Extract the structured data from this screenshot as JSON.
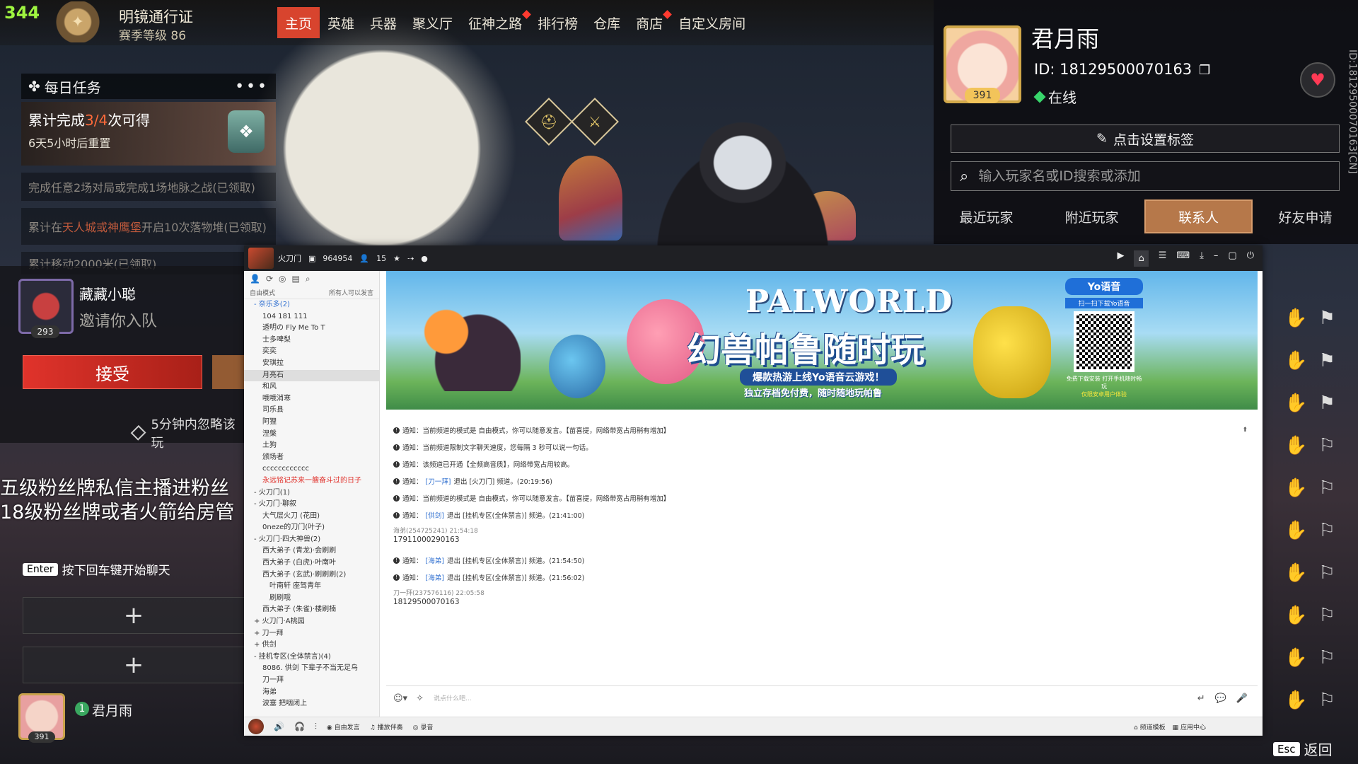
{
  "top": {
    "level": "344",
    "pass_title": "明镜通行证",
    "pass_level": "赛季等级 86",
    "nav": [
      {
        "label": "主页",
        "active": true,
        "badge": false
      },
      {
        "label": "英雄",
        "active": false,
        "badge": false
      },
      {
        "label": "兵器",
        "active": false,
        "badge": false
      },
      {
        "label": "聚义厅",
        "active": false,
        "badge": false
      },
      {
        "label": "征神之路",
        "active": false,
        "badge": true
      },
      {
        "label": "排行榜",
        "active": false,
        "badge": false
      },
      {
        "label": "仓库",
        "active": false,
        "badge": false
      },
      {
        "label": "商店",
        "active": false,
        "badge": true
      },
      {
        "label": "自定义房间",
        "active": false,
        "badge": false
      }
    ]
  },
  "daily": {
    "title": "每日任务",
    "more": "•••",
    "progress_prefix": "累计完成",
    "progress_value": "3/4",
    "progress_suffix": "次可得",
    "reset": "6天5小时后重置",
    "task1": "完成任意2场对局或完成1场地脉之战(已领取)",
    "task2_prefix": "累计在",
    "task2_hl": "天人城或神鹰堡",
    "task2_suffix": "开启10次落物堆(已领取)",
    "task3": "累计移动2000米(已领取)"
  },
  "invite": {
    "name": "藏藏小聪",
    "level": "293",
    "message": "邀请你入队",
    "accept": "接受",
    "ignore": "5分钟内忽略该玩"
  },
  "overlay_chat": {
    "line1": "五级粉丝牌私信主播进粉丝",
    "line2": "18级粉丝牌或者火箭给房管"
  },
  "enter_hint": {
    "key": "Enter",
    "text": "按下回车键开始聊天"
  },
  "self": {
    "name": "君月雨",
    "level": "391",
    "rank": "1"
  },
  "profile": {
    "name": "君月雨",
    "level": "391",
    "id": "ID: 18129500070163",
    "status": "在线",
    "vertical_id": "ID:18129500070163[CN]",
    "set_tag": "点击设置标签",
    "search_placeholder": "输入玩家名或ID搜索或添加",
    "tabs": [
      {
        "label": "最近玩家",
        "active": false
      },
      {
        "label": "附近玩家",
        "active": false
      },
      {
        "label": "联系人",
        "active": true
      },
      {
        "label": "好友申请",
        "active": false
      }
    ]
  },
  "esc_hint": {
    "key": "Esc",
    "text": "返回"
  },
  "yy": {
    "title": "火刀门",
    "channel_id": "964954",
    "online": "15",
    "mode": "自由模式",
    "all_can_speak": "所有人可以发言",
    "tree": [
      {
        "text": "- 奈乐多(2)",
        "cls": "blue"
      },
      {
        "text": "104 181  111",
        "cls": "l1"
      },
      {
        "text": "透明の  Fly Me To T",
        "cls": "l1"
      },
      {
        "text": "士多啤梨",
        "cls": "l1"
      },
      {
        "text": "奕奕",
        "cls": "l1"
      },
      {
        "text": "安琪拉",
        "cls": "l1"
      },
      {
        "text": "月亮石",
        "cls": "l1 sel"
      },
      {
        "text": "和风",
        "cls": "l1"
      },
      {
        "text": "哦哦消寒",
        "cls": "l1"
      },
      {
        "text": "司乐县",
        "cls": "l1"
      },
      {
        "text": "阿狸",
        "cls": "l1"
      },
      {
        "text": "涅槃",
        "cls": "l1"
      },
      {
        "text": "土狗",
        "cls": "l1"
      },
      {
        "text": "颁场者",
        "cls": "l1"
      },
      {
        "text": "cccccccccccc",
        "cls": "l1"
      },
      {
        "text": "永远铭记苏来一艘奋斗过的日子",
        "cls": "l1 red"
      },
      {
        "text": "- 火刀门(1)",
        "cls": ""
      },
      {
        "text": "- 火刀门·聊叙",
        "cls": ""
      },
      {
        "text": "大气层火刀 (花田)",
        "cls": "l1"
      },
      {
        "text": "0neze的刀门(叶子)",
        "cls": "l1"
      },
      {
        "text": "- 火刀门·四大神兽(2)",
        "cls": ""
      },
      {
        "text": "西大弟子 (青龙)·会刷刷",
        "cls": "l1"
      },
      {
        "text": "西大弟子 (白虎)·叶南叶",
        "cls": "l1"
      },
      {
        "text": "西大弟子 (玄武)·刷刷刷(2)",
        "cls": "l1"
      },
      {
        "text": "叶南轩  座驾青年",
        "cls": "l2"
      },
      {
        "text": "刷刷哦",
        "cls": "l2"
      },
      {
        "text": "西大弟子 (朱雀)·楼刷楠",
        "cls": "l1"
      },
      {
        "text": "+ 火刀门·A桃园",
        "cls": ""
      },
      {
        "text": "+ 刀一拜",
        "cls": ""
      },
      {
        "text": "+ 供剑",
        "cls": ""
      },
      {
        "text": "- 挂机专区(全体禁言)(4)",
        "cls": ""
      },
      {
        "text": "8086. 供剑  下辈子不当无足鸟",
        "cls": "l1"
      },
      {
        "text": "刀一拜",
        "cls": "l1"
      },
      {
        "text": "海弟",
        "cls": "l1"
      },
      {
        "text": "波塞  把咽闭上",
        "cls": "l1"
      }
    ],
    "banner": {
      "title": "PALWORLD",
      "slogan": "幻兽帕鲁随时玩",
      "sub1": "爆款热游上线Yo语音云游戏！",
      "sub2": "独立存档免付费，随时随地玩帕鲁",
      "yo_brand": "Yo语音",
      "qr_caption": "扫一扫下载Yo语音",
      "free": "免费下载安装 打开手机随时畅玩",
      "android": "仅限安卓用户体验"
    },
    "messages": [
      {
        "type": "notice",
        "text": "通知：当前频道的模式是 自由模式，你可以随意发言。【苗喜提，网络带宽占用稍有增加】"
      },
      {
        "type": "notice",
        "text": "通知：当前频道限制文字聊天速度，您每隔 3 秒可以说一句话。"
      },
      {
        "type": "notice",
        "text": "通知：该频道已开通【全频高音质】，网络带宽占用较高。"
      },
      {
        "type": "notice",
        "pre": "通知：",
        "who": "[刀一拜]",
        "text": " 退出 [火刀门] 频道。(20:19:56)"
      },
      {
        "type": "notice",
        "text": "通知：当前频道的模式是 自由模式，你可以随意发言。【苗喜提，网络带宽占用稍有增加】"
      },
      {
        "type": "notice",
        "pre": "通知：",
        "who": "[供剑]",
        "text": " 退出 [挂机专区(全体禁言)] 频道。(21:41:00)"
      },
      {
        "type": "user",
        "user": "海弟(254725241)  21:54:18",
        "body": "17911000290163"
      },
      {
        "type": "notice",
        "pre": "通知：",
        "who": "[海弟]",
        "text": " 退出 [挂机专区(全体禁言)] 频道。(21:54:50)"
      },
      {
        "type": "notice",
        "pre": "通知：",
        "who": "[海弟]",
        "text": " 退出 [挂机专区(全体禁言)] 频道。(21:56:02)"
      },
      {
        "type": "user",
        "user": "刀一拜(237576116)  22:05:58",
        "body": "18129500070163"
      }
    ],
    "input_placeholder": "说点什么吧...",
    "bottom": {
      "free_speak": "自由发言",
      "play_music": "播放伴奏",
      "record": "录音",
      "template": "频道模板",
      "app_center": "应用中心"
    }
  }
}
